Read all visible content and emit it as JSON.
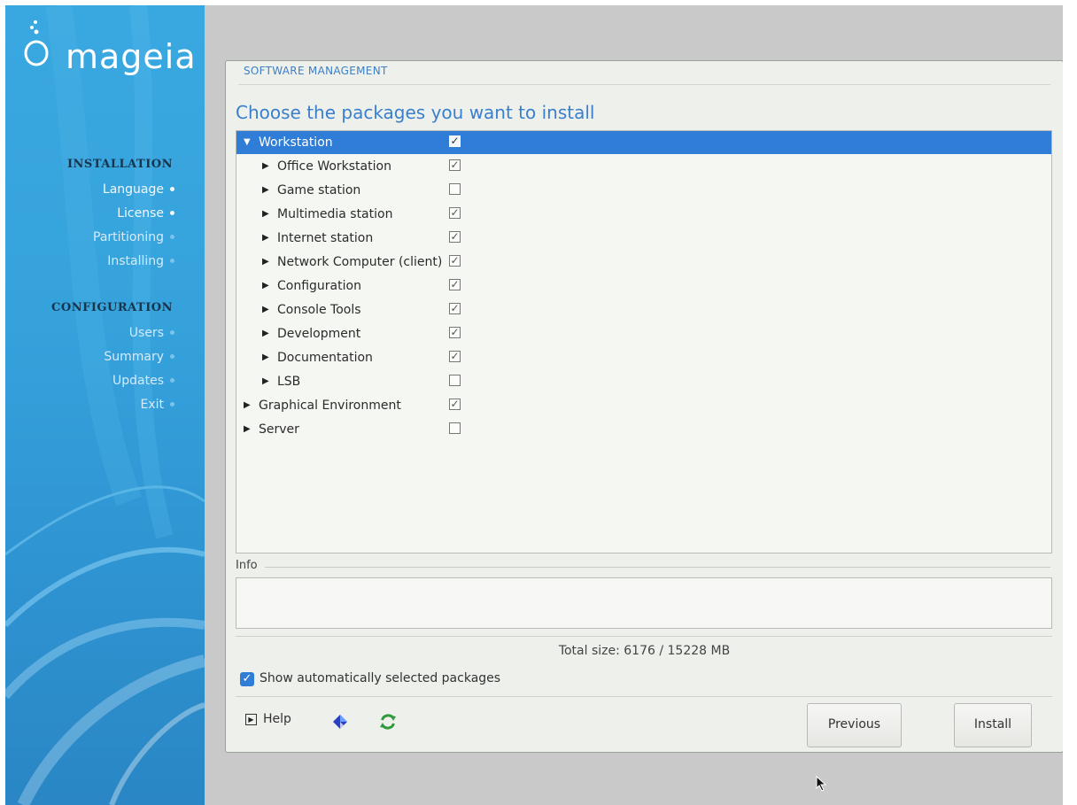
{
  "brand": {
    "name": "mageia"
  },
  "sidebar": {
    "sections": [
      {
        "title": "INSTALLATION",
        "items": [
          {
            "label": "Language",
            "state": "done"
          },
          {
            "label": "License",
            "state": "done"
          },
          {
            "label": "Partitioning",
            "state": "todo"
          },
          {
            "label": "Installing",
            "state": "todo"
          }
        ]
      },
      {
        "title": "CONFIGURATION",
        "items": [
          {
            "label": "Users",
            "state": "todo"
          },
          {
            "label": "Summary",
            "state": "todo"
          },
          {
            "label": "Updates",
            "state": "todo"
          },
          {
            "label": "Exit",
            "state": "todo"
          }
        ]
      }
    ]
  },
  "panel": {
    "header": "SOFTWARE MANAGEMENT",
    "title": "Choose the packages you want to install",
    "packages": [
      {
        "label": "Workstation",
        "level": 0,
        "expanded": true,
        "checked": true,
        "selected": true
      },
      {
        "label": "Office Workstation",
        "level": 1,
        "expanded": false,
        "checked": true,
        "selected": false
      },
      {
        "label": "Game station",
        "level": 1,
        "expanded": false,
        "checked": false,
        "selected": false
      },
      {
        "label": "Multimedia station",
        "level": 1,
        "expanded": false,
        "checked": true,
        "selected": false
      },
      {
        "label": "Internet station",
        "level": 1,
        "expanded": false,
        "checked": true,
        "selected": false
      },
      {
        "label": "Network Computer (client)",
        "level": 1,
        "expanded": false,
        "checked": true,
        "selected": false
      },
      {
        "label": "Configuration",
        "level": 1,
        "expanded": false,
        "checked": true,
        "selected": false
      },
      {
        "label": "Console Tools",
        "level": 1,
        "expanded": false,
        "checked": true,
        "selected": false
      },
      {
        "label": "Development",
        "level": 1,
        "expanded": false,
        "checked": true,
        "selected": false
      },
      {
        "label": "Documentation",
        "level": 1,
        "expanded": false,
        "checked": true,
        "selected": false
      },
      {
        "label": "LSB",
        "level": 1,
        "expanded": false,
        "checked": false,
        "selected": false
      },
      {
        "label": "Graphical Environment",
        "level": 0,
        "expanded": false,
        "checked": true,
        "selected": false
      },
      {
        "label": "Server",
        "level": 0,
        "expanded": false,
        "checked": false,
        "selected": false
      }
    ],
    "info_label": "Info",
    "info_text": "",
    "total_size": "Total size: 6176 / 15228 MB",
    "show_auto": {
      "label": "Show automatically selected packages",
      "checked": true
    },
    "help_label": "Help",
    "toolbar_icons": [
      "diamond-icon",
      "refresh-icon"
    ],
    "buttons": {
      "previous": "Previous",
      "install": "Install"
    }
  },
  "colors": {
    "accent": "#2f7dd6",
    "title": "#3a7fcc",
    "sidebar": "#35a2dc"
  }
}
